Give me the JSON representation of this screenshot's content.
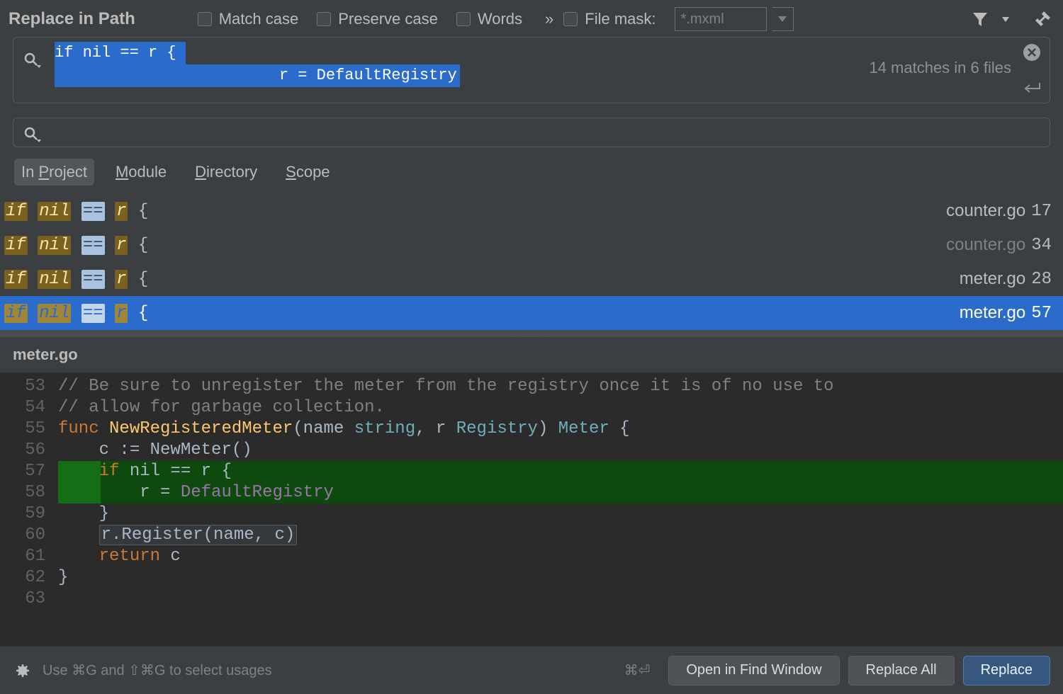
{
  "title": "Replace in Path",
  "options": {
    "match_case": "Match case",
    "preserve_case": "Preserve case",
    "words": "Words",
    "file_mask_label": "File mask:",
    "file_mask_value": "*.mxml"
  },
  "search": {
    "line1": "if nil == r { ",
    "line2_indent": "                        ",
    "line2": "r = DefaultRegistry",
    "result_count": "14 matches in 6 files"
  },
  "scope_tabs": {
    "in_project": {
      "pre": "In ",
      "u": "P",
      "post": "roject"
    },
    "module": {
      "u": "M",
      "post": "odule"
    },
    "directory": {
      "u": "D",
      "post": "irectory"
    },
    "scope": {
      "u": "S",
      "post": "cope"
    }
  },
  "results": [
    {
      "match": "if nil == r {",
      "file": "counter.go",
      "line": "17",
      "dim": false,
      "selected": false
    },
    {
      "match": "if nil == r {",
      "file": "counter.go",
      "line": "34",
      "dim": true,
      "selected": false
    },
    {
      "match": "if nil == r {",
      "file": "meter.go",
      "line": "28",
      "dim": false,
      "selected": false
    },
    {
      "match": "if nil == r {",
      "file": "meter.go",
      "line": "57",
      "dim": false,
      "selected": true
    }
  ],
  "preview": {
    "filename": "meter.go",
    "lines": {
      "l53": "// Be sure to unregister the meter from the registry once it is of no use to",
      "l54": "// allow for garbage collection.",
      "l55_func": "func",
      "l55_name": " NewRegisteredMeter",
      "l55_args_open": "(",
      "l55_p1": "name ",
      "l55_t1": "string",
      "l55_comma": ", ",
      "l55_p2": "r ",
      "l55_t2": "Registry",
      "l55_args_close": ") ",
      "l55_ret": "Meter",
      "l55_brace": " {",
      "l56": "    c := NewMeter()",
      "l56_c": "c",
      "l56_assign": " := ",
      "l56_call": "NewMeter()",
      "l57_if": "if",
      "l57_rest": " nil == r {",
      "l58_r": "r",
      "l58_eq": " = ",
      "l58_val": "DefaultRegistry",
      "l59": "    }",
      "l60_r": "r",
      "l60_call": ".Register(name, c)",
      "l61_ret": "return",
      "l61_c": " c",
      "l62": "}"
    },
    "line_numbers": [
      "53",
      "54",
      "55",
      "56",
      "57",
      "58",
      "59",
      "60",
      "61",
      "62",
      "63"
    ]
  },
  "footer": {
    "hint": "Use ⌘G and ⇧⌘G to select usages",
    "shortcut": "⌘⏎",
    "open": "Open in Find Window",
    "replace_all": "Replace All",
    "replace": "Replace"
  }
}
